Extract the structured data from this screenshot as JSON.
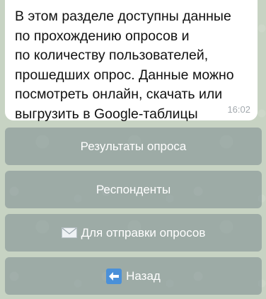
{
  "message": {
    "text": "В этом разделе доступны данные\nпо прохождению опросов и\nпо количеству пользователей,\nпрошедших опрос. Данные можно\nпосмотреть онлайн, скачать или\nвыгрузить в Google-таблицы",
    "time": "16:02"
  },
  "keyboard": {
    "buttons": [
      {
        "label": "Результаты опроса"
      },
      {
        "label": "Респонденты"
      },
      {
        "label": "Для отправки опросов",
        "icon": "envelope-icon"
      },
      {
        "label": "Назад",
        "icon": "back-arrow-icon"
      }
    ]
  },
  "colors": {
    "chat_background": "#c7d3c3",
    "button_background": "#7a8a8e",
    "back_icon": "#4a90d9"
  }
}
